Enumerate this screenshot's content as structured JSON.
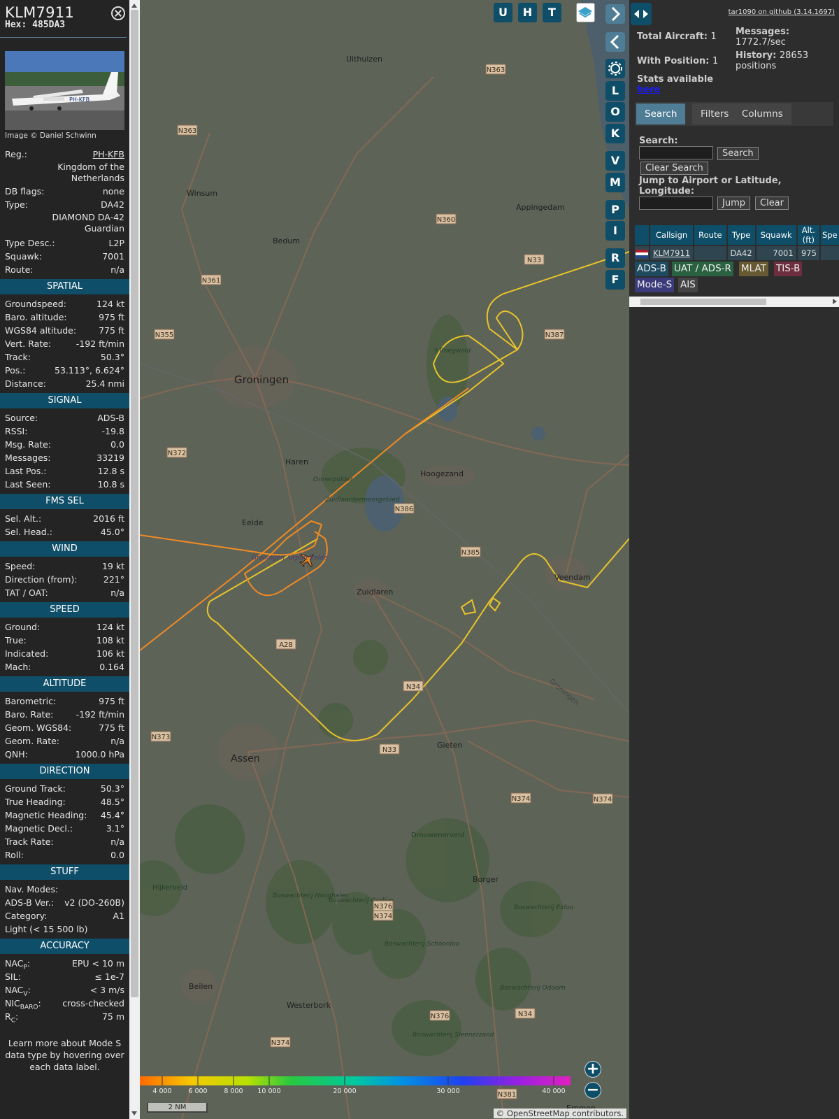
{
  "aircraft": {
    "callsign": "KLM7911",
    "hex_label": "Hex:",
    "hex": "485DA3",
    "photo_credit": "Image © Daniel Schwinn",
    "photo_reg_text": "PH-KFB",
    "reg_label": "Reg.:",
    "reg": "PH-KFB",
    "country": "Kingdom of the Netherlands",
    "db_flags_label": "DB flags:",
    "db_flags": "none",
    "type_label": "Type:",
    "type": "DA42",
    "type_full": "DIAMOND DA-42 Guardian",
    "type_desc_label": "Type Desc.:",
    "type_desc": "L2P",
    "squawk_label": "Squawk:",
    "squawk": "7001",
    "route_label": "Route:",
    "route": "n/a"
  },
  "sections": {
    "spatial": "SPATIAL",
    "signal": "SIGNAL",
    "fms": "FMS SEL",
    "wind": "WIND",
    "speed": "SPEED",
    "altitude": "ALTITUDE",
    "direction": "DIRECTION",
    "stuff": "STUFF",
    "accuracy": "ACCURACY"
  },
  "spatial": [
    {
      "label": "Groundspeed:",
      "value": "124 kt"
    },
    {
      "label": "Baro. altitude:",
      "value": "975 ft"
    },
    {
      "label": "WGS84 altitude:",
      "value": "775 ft"
    },
    {
      "label": "Vert. Rate:",
      "value": "-192 ft/min"
    },
    {
      "label": "Track:",
      "value": "50.3°"
    },
    {
      "label": "Pos.:",
      "value": "53.113°, 6.624°"
    },
    {
      "label": "Distance:",
      "value": "25.4 nmi"
    }
  ],
  "signal": [
    {
      "label": "Source:",
      "value": "ADS-B"
    },
    {
      "label": "RSSI:",
      "value": "-19.8"
    },
    {
      "label": "Msg. Rate:",
      "value": "0.0"
    },
    {
      "label": "Messages:",
      "value": "33219"
    },
    {
      "label": "Last Pos.:",
      "value": "12.8 s"
    },
    {
      "label": "Last Seen:",
      "value": "10.8 s"
    }
  ],
  "fms": [
    {
      "label": "Sel. Alt.:",
      "value": "2016 ft"
    },
    {
      "label": "Sel. Head.:",
      "value": "45.0°"
    }
  ],
  "wind": [
    {
      "label": "Speed:",
      "value": "19 kt"
    },
    {
      "label": "Direction (from):",
      "value": "221°"
    },
    {
      "label": "TAT / OAT:",
      "value": "n/a"
    }
  ],
  "speed": [
    {
      "label": "Ground:",
      "value": "124 kt"
    },
    {
      "label": "True:",
      "value": "108 kt"
    },
    {
      "label": "Indicated:",
      "value": "106 kt"
    },
    {
      "label": "Mach:",
      "value": "0.164"
    }
  ],
  "altitude": [
    {
      "label": "Barometric:",
      "value": "975 ft"
    },
    {
      "label": "Baro. Rate:",
      "value": "-192 ft/min"
    },
    {
      "label": "Geom. WGS84:",
      "value": "775 ft"
    },
    {
      "label": "Geom. Rate:",
      "value": "n/a"
    },
    {
      "label": "QNH:",
      "value": "1000.0 hPa"
    }
  ],
  "direction": [
    {
      "label": "Ground Track:",
      "value": "50.3°"
    },
    {
      "label": "True Heading:",
      "value": "48.5°"
    },
    {
      "label": "Magnetic Heading:",
      "value": "45.4°"
    },
    {
      "label": "Magnetic Decl.:",
      "value": "3.1°"
    },
    {
      "label": "Track Rate:",
      "value": "n/a"
    },
    {
      "label": "Roll:",
      "value": "0.0"
    }
  ],
  "stuff": {
    "nav_modes_label": "Nav. Modes:",
    "nav_modes": "",
    "adsb_ver_label": "ADS-B Ver.:",
    "adsb_ver": "v2 (DO-260B)",
    "category_label": "Category:",
    "category": "A1",
    "category_desc": "Light (< 15 500 lb)"
  },
  "accuracy": {
    "nacp_main": "NAC",
    "nacp_sub": "P",
    "nacp": "EPU < 10 m",
    "sil_label": "SIL:",
    "sil": "≤ 1e-7",
    "nacv_main": "NAC",
    "nacv_sub": "V",
    "nacv": "< 3 m/s",
    "nicbaro_main": "NIC",
    "nicbaro_sub": "BARO",
    "nicbaro": "cross-checked",
    "rc_main": "R",
    "rc_sub": "C",
    "rc": "75 m"
  },
  "learn_more": "Learn more about Mode S data type by hovering over each data label.",
  "map": {
    "top_buttons": [
      "U",
      "H",
      "T"
    ],
    "side_buttons": [
      "L",
      "O",
      "K",
      "V",
      "M",
      "P",
      "I",
      "R",
      "F"
    ],
    "places": [
      {
        "name": "Uithuizen"
      },
      {
        "name": "Winsum"
      },
      {
        "name": "Bedum"
      },
      {
        "name": "Appingedam"
      },
      {
        "name": "Groningen"
      },
      {
        "name": "Haren"
      },
      {
        "name": "Hoogezand"
      },
      {
        "name": "Eelde"
      },
      {
        "name": "Groningen Airport Eelde"
      },
      {
        "name": "Zuidlaren"
      },
      {
        "name": "Veendam"
      },
      {
        "name": "Assen"
      },
      {
        "name": "Gieten"
      },
      {
        "name": "Borger"
      },
      {
        "name": "Beilen"
      },
      {
        "name": "Westerbork"
      },
      {
        "name": "Drouwenerveld"
      },
      {
        "name": "Hijkerveld"
      },
      {
        "name": "Onnerpolder"
      },
      {
        "name": "Zuidlaardermeergebied"
      },
      {
        "name": "'t Roegwold"
      },
      {
        "name": "Boswachterij Hooghalen"
      },
      {
        "name": "Boswachterij Grolloo"
      },
      {
        "name": "Boswachterij Schoonloo"
      },
      {
        "name": "Boswachterij Exloo"
      },
      {
        "name": "Boswachterij Odoorn"
      },
      {
        "name": "Boswachterij Sleenerzand"
      },
      {
        "name": "Emmen"
      },
      {
        "name": "Groningen"
      }
    ],
    "roads": [
      "N363",
      "N363",
      "N360",
      "N361",
      "N355",
      "N33",
      "N387",
      "N372",
      "N386",
      "N385",
      "A28",
      "N34",
      "N373",
      "N33",
      "N374",
      "N374",
      "N376",
      "N374",
      "N34",
      "N376",
      "N374",
      "N381"
    ],
    "legend_ticks": [
      "4 000",
      "6 000",
      "8 000",
      "10 000",
      "20 000",
      "30 000",
      "40 000"
    ],
    "scale": "2 NM",
    "attribution_prefix": "© ",
    "attribution_link": "OpenStreetMap",
    "attribution_suffix": " contributors."
  },
  "panel": {
    "github": "tar1090 on github (3.14.1697)",
    "total_label": "Total Aircraft:",
    "total": "1",
    "position_label": "With Position:",
    "position": "1",
    "messages_label": "Messages:",
    "messages": "1772.7/sec",
    "history_label": "History:",
    "history_count": "28653",
    "history_unit": "positions",
    "stats_label": "Stats available",
    "stats_link": "here",
    "tabs": [
      "Search",
      "Filters",
      "Columns"
    ],
    "search_label": "Search:",
    "search_button": "Search",
    "clear_search": "Clear Search",
    "jump_label": "Jump to Airport or Latitude, Longitude:",
    "jump_button": "Jump",
    "clear_button": "Clear"
  },
  "table": {
    "headers": [
      "Callsign",
      "Route",
      "Type",
      "Squawk",
      "Alt. (ft)",
      "Spe"
    ],
    "row": {
      "callsign": "KLM7911",
      "route": "",
      "type": "DA42",
      "squawk": "7001",
      "alt": "975",
      "speed": ""
    }
  },
  "sources": [
    {
      "label": "ADS-B",
      "color": "#1f4b61"
    },
    {
      "label": "UAT / ADS-R",
      "color": "#2a6140"
    },
    {
      "label": "MLAT",
      "color": "#675a32"
    },
    {
      "label": "TIS-B",
      "color": "#6d2f40"
    },
    {
      "label": "Mode-S",
      "color": "#3b3b7c"
    },
    {
      "label": "AIS",
      "color": "#444444"
    }
  ]
}
